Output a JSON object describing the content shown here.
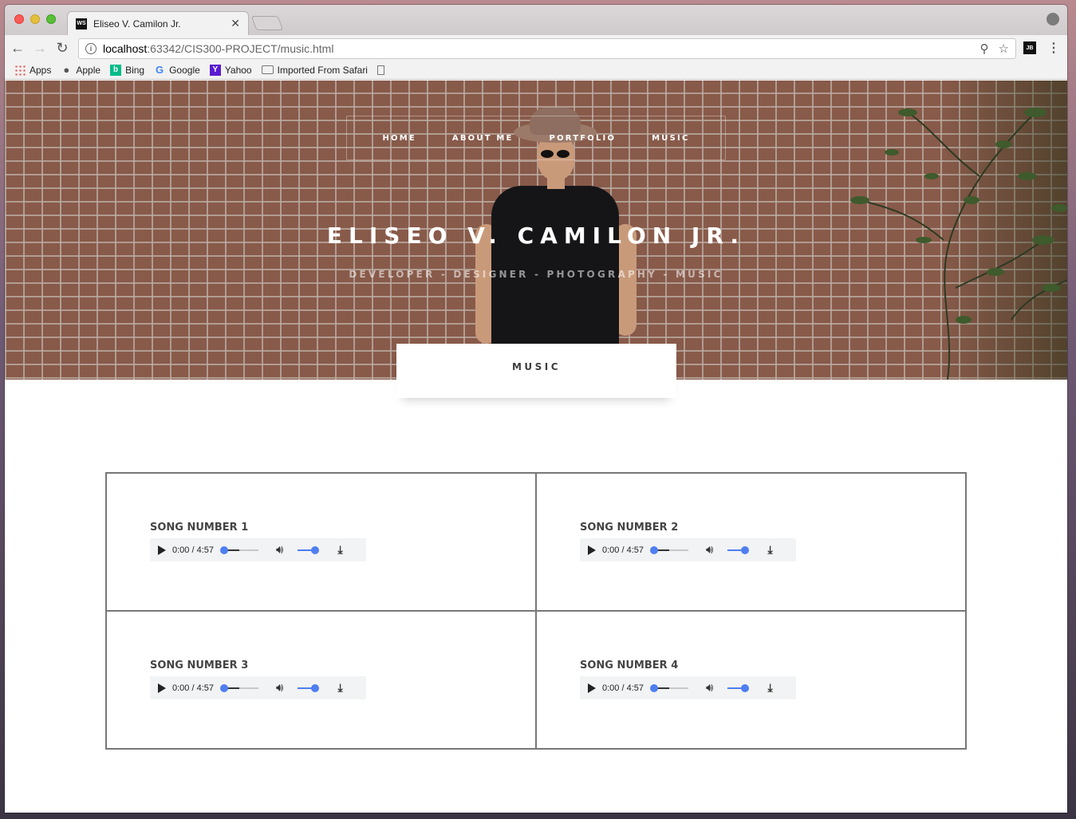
{
  "browser": {
    "tab_title": "Eliseo V. Camilon Jr.",
    "url_host": "localhost",
    "url_path": ":63342/CIS300-PROJECT/music.html",
    "bookmarks": [
      {
        "label": "Apps",
        "icon": "apps-icon"
      },
      {
        "label": "Apple",
        "icon": "apple-icon"
      },
      {
        "label": "Bing",
        "icon": "bing-icon"
      },
      {
        "label": "Google",
        "icon": "google-icon"
      },
      {
        "label": "Yahoo",
        "icon": "yahoo-icon"
      },
      {
        "label": "Imported From Safari",
        "icon": "folder-icon"
      }
    ]
  },
  "nav": {
    "items": [
      "HOME",
      "ABOUT ME",
      "PORTFOLIO",
      "MUSIC"
    ]
  },
  "hero": {
    "title": "ELISEO V. CAMILON JR.",
    "subtitle": "DEVELOPER - DESIGNER - PHOTOGRAPHY - MUSIC"
  },
  "section": {
    "title": "MUSIC"
  },
  "songs": [
    {
      "title": "SONG NUMBER 1",
      "time": "0:00 / 4:57"
    },
    {
      "title": "SONG NUMBER 2",
      "time": "0:00 / 4:57"
    },
    {
      "title": "SONG NUMBER 3",
      "time": "0:00 / 4:57"
    },
    {
      "title": "SONG NUMBER 4",
      "time": "0:00 / 4:57"
    }
  ],
  "colors": {
    "accent": "#4f7ef0"
  }
}
